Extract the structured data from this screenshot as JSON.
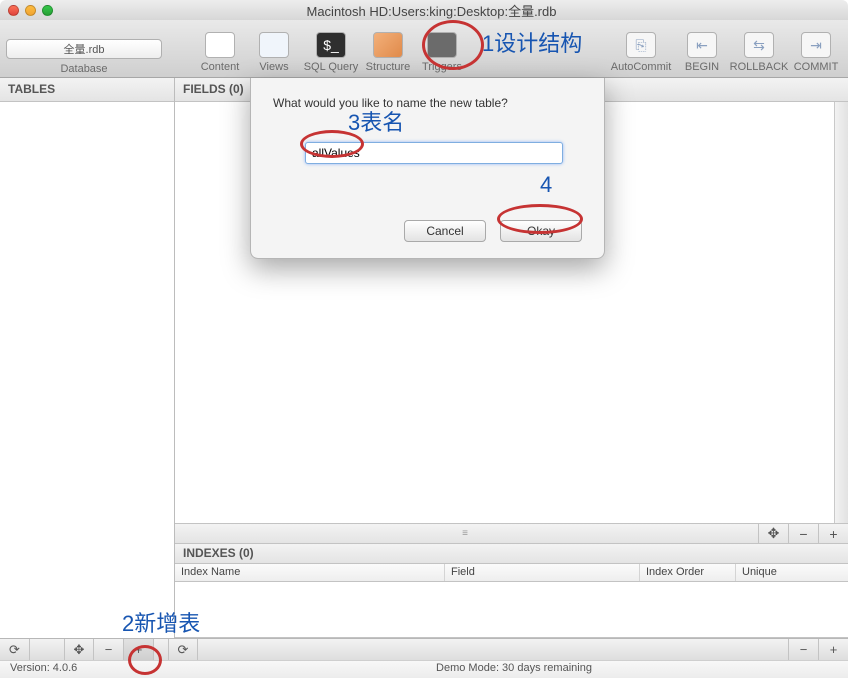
{
  "window": {
    "title": "Macintosh HD:Users:king:Desktop:全量.rdb"
  },
  "toolbar": {
    "db_value": "全量.rdb",
    "db_label": "Database",
    "buttons": {
      "content": "Content",
      "views": "Views",
      "sqlquery": "SQL Query",
      "structure": "Structure",
      "triggers": "Triggers",
      "autocommit": "AutoCommit",
      "begin": "BEGIN",
      "rollback": "ROLLBACK",
      "commit": "COMMIT"
    }
  },
  "sidebar": {
    "header": "TABLES"
  },
  "fields": {
    "header": "FIELDS (0)",
    "toolbar_handle": "≡"
  },
  "indexes": {
    "header": "INDEXES (0)",
    "cols": {
      "name": "Index Name",
      "field": "Field",
      "order": "Index Order",
      "unique": "Unique"
    }
  },
  "bottombar": {
    "refresh1": "⟳",
    "move": "✥",
    "minus1": "−",
    "plus1": "+",
    "refresh2": "⟳",
    "minus2": "−",
    "plus2": "+",
    "fields_move": "✥",
    "fields_minus": "−",
    "fields_plus": "+"
  },
  "status": {
    "version": "Version: 4.0.6",
    "demo": "Demo Mode: 30 days remaining"
  },
  "dialog": {
    "prompt": "What would you like to name the new table?",
    "value": "allValues",
    "cancel": "Cancel",
    "ok": "Okay"
  },
  "annotations": {
    "a1": "1设计结构",
    "a2": "2新增表",
    "a3": "3表名",
    "a4": "4"
  }
}
